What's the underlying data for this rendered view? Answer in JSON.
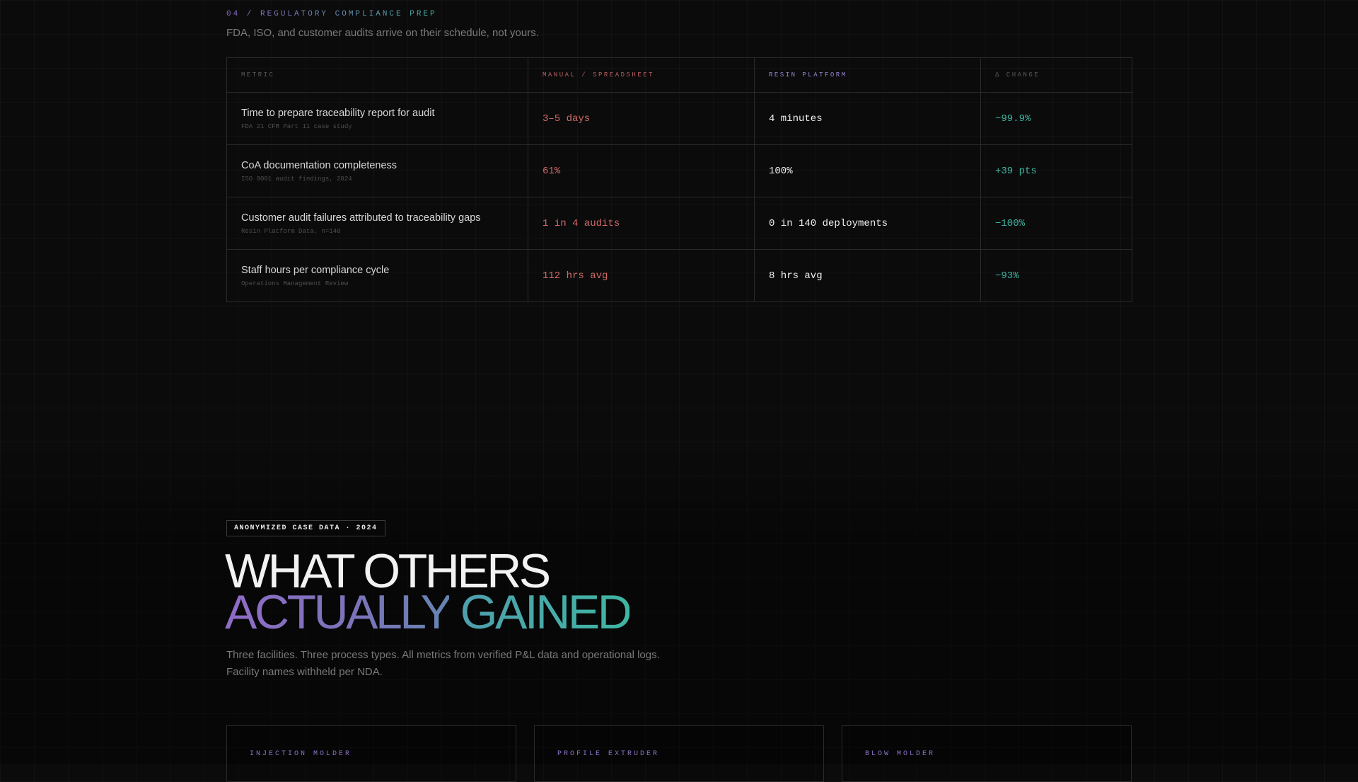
{
  "compliance": {
    "eyebrow": "04 / REGULATORY COMPLIANCE PREP",
    "subtitle": "FDA, ISO, and customer audits arrive on their schedule, not yours.",
    "headers": [
      "METRIC",
      "MANUAL / SPREADSHEET",
      "RESIN PLATFORM",
      "Δ CHANGE"
    ],
    "rows": [
      {
        "metric": "Time to prepare traceability report for audit",
        "source": "FDA 21 CFR Part 11 case study",
        "manual": "3–5 days",
        "resin": "4 minutes",
        "change": "−99.9%"
      },
      {
        "metric": "CoA documentation completeness",
        "source": "ISO 9001 audit findings, 2024",
        "manual": "61%",
        "resin": "100%",
        "change": "+39 pts"
      },
      {
        "metric": "Customer audit failures attributed to traceability gaps",
        "source": "Resin Platform Data, n=140",
        "manual": "1 in 4 audits",
        "resin": "0 in 140 deployments",
        "change": "−100%"
      },
      {
        "metric": "Staff hours per compliance cycle",
        "source": "Operations Management Review",
        "manual": "112 hrs avg",
        "resin": "8 hrs avg",
        "change": "−93%"
      }
    ]
  },
  "cases": {
    "badge": "ANONYMIZED CASE DATA · 2024",
    "headline_line1": "WHAT OTHERS",
    "headline_line2a": "ACTUALLY",
    "headline_line2b": "GAINED",
    "subtitle_line1": "Three facilities. Three process types. All metrics from verified P&L data and operational logs.",
    "subtitle_line2": "Facility names withheld per NDA.",
    "cards": [
      {
        "label": "INJECTION MOLDER"
      },
      {
        "label": "PROFILE EXTRUDER"
      },
      {
        "label": "BLOW MOLDER"
      }
    ]
  },
  "colors": {
    "background": "#0b0b0b",
    "manual_red": "#d46a6a",
    "resin_white": "#f0f0f0",
    "change_teal": "#3fb6a3",
    "accent_purple": "#8f6cc7"
  }
}
